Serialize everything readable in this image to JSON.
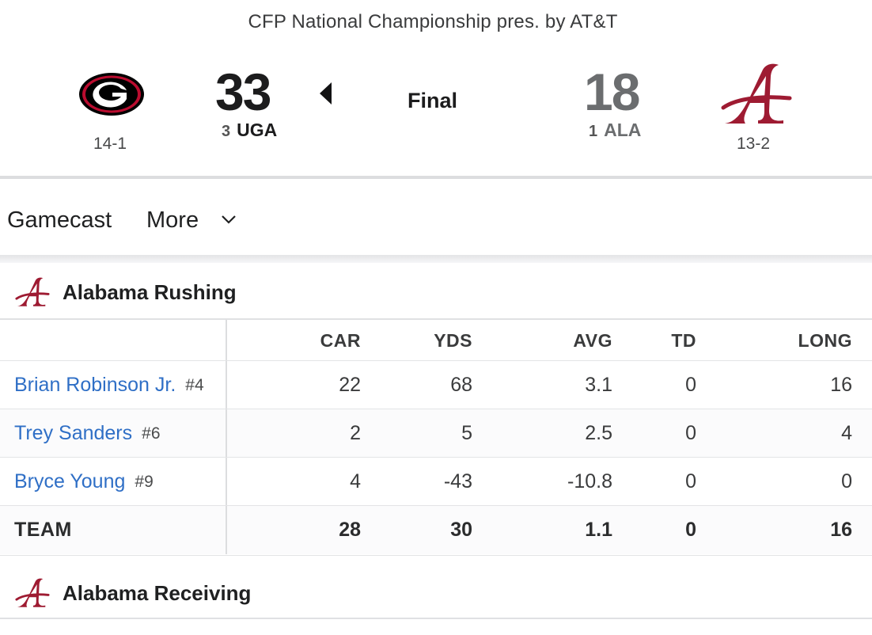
{
  "header": {
    "event_title": "CFP National Championship pres. by AT&T",
    "status": "Final",
    "home": {
      "abbr": "UGA",
      "rank": "3",
      "score": "33",
      "record": "14-1",
      "logo": "georgia-g-logo",
      "winner": true
    },
    "away": {
      "abbr": "ALA",
      "rank": "1",
      "score": "18",
      "record": "13-2",
      "logo": "alabama-a-logo"
    }
  },
  "nav": {
    "gamecast": "Gamecast",
    "more": "More"
  },
  "rushing": {
    "title": "Alabama Rushing",
    "columns": [
      "CAR",
      "YDS",
      "AVG",
      "TD",
      "LONG"
    ],
    "players": [
      {
        "name": "Brian Robinson Jr.",
        "number": "#4",
        "car": "22",
        "yds": "68",
        "avg": "3.1",
        "td": "0",
        "long": "16"
      },
      {
        "name": "Trey Sanders",
        "number": "#6",
        "car": "2",
        "yds": "5",
        "avg": "2.5",
        "td": "0",
        "long": "4"
      },
      {
        "name": "Bryce Young",
        "number": "#9",
        "car": "4",
        "yds": "-43",
        "avg": "-10.8",
        "td": "0",
        "long": "0"
      }
    ],
    "team": {
      "label": "TEAM",
      "car": "28",
      "yds": "30",
      "avg": "1.1",
      "td": "0",
      "long": "16"
    }
  },
  "receiving": {
    "title": "Alabama Receiving"
  },
  "colors": {
    "link": "#2f6fc6",
    "alabama_crimson": "#9e1b32",
    "georgia_red": "#ba0c2f"
  }
}
